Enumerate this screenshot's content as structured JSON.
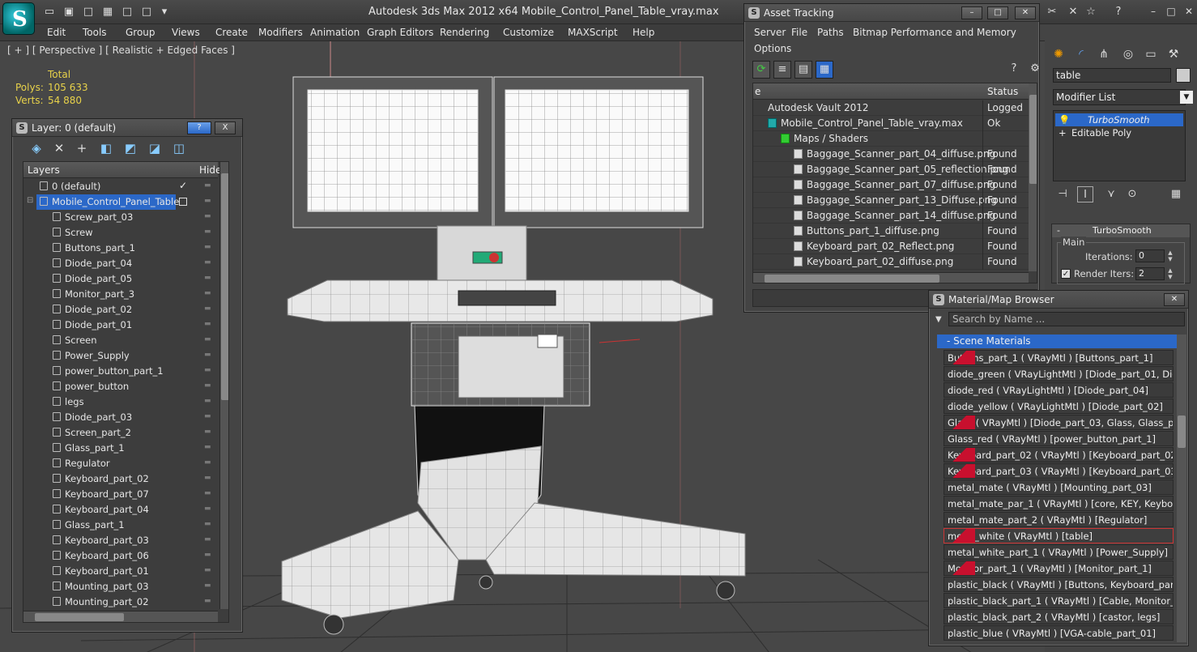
{
  "window": {
    "title": "Autodesk 3ds Max  2012 x64     Mobile_Control_Panel_Table_vray.max"
  },
  "menu": [
    "Edit",
    "Tools",
    "Group",
    "Views",
    "Create",
    "Modifiers",
    "Animation",
    "Graph Editors",
    "Rendering",
    "Customize",
    "MAXScript",
    "Help"
  ],
  "viewport": {
    "label": "[ + ] [ Perspective ] [ Realistic + Edged Faces ]",
    "stats": {
      "total_label": "Total",
      "polys_label": "Polys:",
      "polys_value": "105 633",
      "verts_label": "Verts:",
      "verts_value": "54 880"
    }
  },
  "layer_panel": {
    "title": "Layer: 0 (default)",
    "help_label": "?",
    "close_label": "X",
    "columns": {
      "layers": "Layers",
      "hide": "Hide"
    },
    "rows": [
      {
        "label": "0 (default)",
        "indent": 0,
        "selected": false,
        "check": "✓"
      },
      {
        "label": "Mobile_Control_Panel_Table",
        "indent": 0,
        "selected": true,
        "check": ""
      },
      {
        "label": "Screw_part_03",
        "indent": 1
      },
      {
        "label": "Screw",
        "indent": 1
      },
      {
        "label": "Buttons_part_1",
        "indent": 1
      },
      {
        "label": "Diode_part_04",
        "indent": 1
      },
      {
        "label": "Diode_part_05",
        "indent": 1
      },
      {
        "label": "Monitor_part_3",
        "indent": 1
      },
      {
        "label": "Diode_part_02",
        "indent": 1
      },
      {
        "label": "Diode_part_01",
        "indent": 1
      },
      {
        "label": "Screen",
        "indent": 1
      },
      {
        "label": "Power_Supply",
        "indent": 1
      },
      {
        "label": "power_button_part_1",
        "indent": 1
      },
      {
        "label": "power_button",
        "indent": 1
      },
      {
        "label": "legs",
        "indent": 1
      },
      {
        "label": "Diode_part_03",
        "indent": 1
      },
      {
        "label": "Screen_part_2",
        "indent": 1
      },
      {
        "label": "Glass_part_1",
        "indent": 1
      },
      {
        "label": "Regulator",
        "indent": 1
      },
      {
        "label": "Keyboard_part_02",
        "indent": 1
      },
      {
        "label": "Keyboard_part_07",
        "indent": 1
      },
      {
        "label": "Keyboard_part_04",
        "indent": 1
      },
      {
        "label": "Glass_part_1",
        "indent": 1
      },
      {
        "label": "Keyboard_part_03",
        "indent": 1
      },
      {
        "label": "Keyboard_part_06",
        "indent": 1
      },
      {
        "label": "Keyboard_part_01",
        "indent": 1
      },
      {
        "label": "Mounting_part_03",
        "indent": 1
      },
      {
        "label": "Mounting_part_02",
        "indent": 1
      }
    ]
  },
  "asset_tracking": {
    "title": "Asset Tracking",
    "menu": [
      "Server",
      "File",
      "Paths",
      "Bitmap Performance and Memory",
      "Options"
    ],
    "columns": {
      "name": "e",
      "status": "Status"
    },
    "rows": [
      {
        "name": "Autodesk Vault 2012",
        "status": "Logged",
        "indent": 0,
        "kind": "vault"
      },
      {
        "name": "Mobile_Control_Panel_Table_vray.max",
        "status": "Ok",
        "indent": 1,
        "kind": "max"
      },
      {
        "name": "Maps / Shaders",
        "status": "",
        "indent": 2,
        "kind": "folder"
      },
      {
        "name": "Baggage_Scanner_part_04_diffuse.png",
        "status": "Found",
        "indent": 3,
        "kind": "file"
      },
      {
        "name": "Baggage_Scanner_part_05_reflection.png",
        "status": "Found",
        "indent": 3,
        "kind": "file"
      },
      {
        "name": "Baggage_Scanner_part_07_diffuse.png",
        "status": "Found",
        "indent": 3,
        "kind": "file"
      },
      {
        "name": "Baggage_Scanner_part_13_Diffuse.png",
        "status": "Found",
        "indent": 3,
        "kind": "file"
      },
      {
        "name": "Baggage_Scanner_part_14_diffuse.png",
        "status": "Found",
        "indent": 3,
        "kind": "file"
      },
      {
        "name": "Buttons_part_1_diffuse.png",
        "status": "Found",
        "indent": 3,
        "kind": "file"
      },
      {
        "name": "Keyboard_part_02_Reflect.png",
        "status": "Found",
        "indent": 3,
        "kind": "file"
      },
      {
        "name": "Keyboard_part_02_diffuse.png",
        "status": "Found",
        "indent": 3,
        "kind": "file"
      }
    ]
  },
  "command_panel": {
    "object_name": "table",
    "modifier_list": "Modifier List",
    "stack": [
      {
        "label": "TurboSmooth",
        "selected": true
      },
      {
        "label": "Editable Poly",
        "selected": false
      }
    ],
    "rollout_title": "TurboSmooth",
    "group_title": "Main",
    "iterations_label": "Iterations:",
    "iterations_value": "0",
    "render_iters_label": "Render Iters:",
    "render_iters_value": "2",
    "render_iters_checked": "✓"
  },
  "material_browser": {
    "title": "Material/Map Browser",
    "search_placeholder": "Search by Name ...",
    "group_title": "- Scene Materials",
    "rows": [
      {
        "label": "Buttons_part_1  ( VRayMtl ) [Buttons_part_1]",
        "swatch": true,
        "highlight": false
      },
      {
        "label": "diode_green  ( VRayLightMtl ) [Diode_part_01, Diod...",
        "swatch": false,
        "highlight": false
      },
      {
        "label": "diode_red  ( VRayLightMtl ) [Diode_part_04]",
        "swatch": false,
        "highlight": false
      },
      {
        "label": "diode_yellow  ( VRayLightMtl ) [Diode_part_02]",
        "swatch": false,
        "highlight": false
      },
      {
        "label": "Glass  ( VRayMtl ) [Diode_part_03, Glass, Glass_part...",
        "swatch": true,
        "highlight": false
      },
      {
        "label": "Glass_red  ( VRayMtl ) [power_button_part_1]",
        "swatch": false,
        "highlight": false
      },
      {
        "label": "Keyboard_part_02  ( VRayMtl ) [Keyboard_part_02]",
        "swatch": true,
        "highlight": false
      },
      {
        "label": "Keyboard_part_03  ( VRayMtl ) [Keyboard_part_03]",
        "swatch": true,
        "highlight": false
      },
      {
        "label": "metal_mate  ( VRayMtl ) [Mounting_part_03]",
        "swatch": false,
        "highlight": false
      },
      {
        "label": "metal_mate_par_1  ( VRayMtl ) [core, KEY, Keyboar...",
        "swatch": false,
        "highlight": false
      },
      {
        "label": "metal_mate_part_2  ( VRayMtl ) [Regulator]",
        "swatch": false,
        "highlight": false
      },
      {
        "label": "metal_white  ( VRayMtl ) [table]",
        "swatch": true,
        "highlight": true
      },
      {
        "label": "metal_white_part_1  ( VRayMtl ) [Power_Supply]",
        "swatch": false,
        "highlight": false
      },
      {
        "label": "Monitor_part_1  ( VRayMtl ) [Monitor_part_1]",
        "swatch": true,
        "highlight": false
      },
      {
        "label": "plastic_black  ( VRayMtl ) [Buttons, Keyboard_part...",
        "swatch": false,
        "highlight": false
      },
      {
        "label": "plastic_black_part_1  ( VRayMtl ) [Cable, Monitor_p...",
        "swatch": false,
        "highlight": false
      },
      {
        "label": "plastic_black_part_2  ( VRayMtl ) [castor, legs]",
        "swatch": false,
        "highlight": false
      },
      {
        "label": "plastic_blue  ( VRayMtl ) [VGA-cable_part_01]",
        "swatch": false,
        "highlight": false
      }
    ]
  },
  "colors": {
    "selection": "#2b68c8",
    "stats": "#e8d24a",
    "swatch_red": "#c8102e"
  }
}
